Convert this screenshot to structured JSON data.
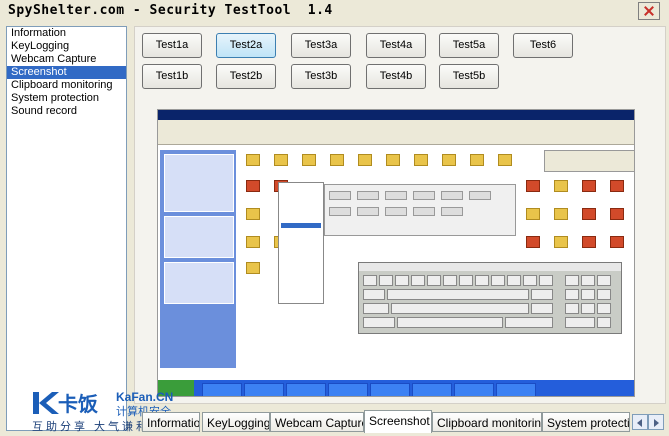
{
  "window": {
    "title": "SpyShelter.com - Security TestTool  1.4"
  },
  "sidebar": {
    "items": [
      {
        "label": "Information",
        "selected": false
      },
      {
        "label": "KeyLogging",
        "selected": false
      },
      {
        "label": "Webcam Capture",
        "selected": false
      },
      {
        "label": "Screenshot",
        "selected": true
      },
      {
        "label": "Clipboard monitoring",
        "selected": false
      },
      {
        "label": "System protection",
        "selected": false
      },
      {
        "label": "Sound record",
        "selected": false
      }
    ]
  },
  "buttons": {
    "test1a": "Test1a",
    "test2a": "Test2a",
    "test3a": "Test3a",
    "test4a": "Test4a",
    "test5a": "Test5a",
    "test6": "Test6",
    "test1b": "Test1b",
    "test2b": "Test2b",
    "test3b": "Test3b",
    "test4b": "Test4b",
    "test5b": "Test5b"
  },
  "tabs": [
    {
      "label": "Information",
      "active": false
    },
    {
      "label": "KeyLogging",
      "active": false
    },
    {
      "label": "Webcam Capture",
      "active": false
    },
    {
      "label": "Screenshot",
      "active": true
    },
    {
      "label": "Clipboard monitoring",
      "active": false
    },
    {
      "label": "System protection",
      "active": false
    }
  ],
  "watermark": {
    "brand_cn": "卡饭",
    "site": "KaFan.CN",
    "security": "计算机安全",
    "slogan": "互助分享  大气谦和"
  },
  "colors": {
    "selection": "#316ac5",
    "brand_blue": "#1b5eb8"
  }
}
